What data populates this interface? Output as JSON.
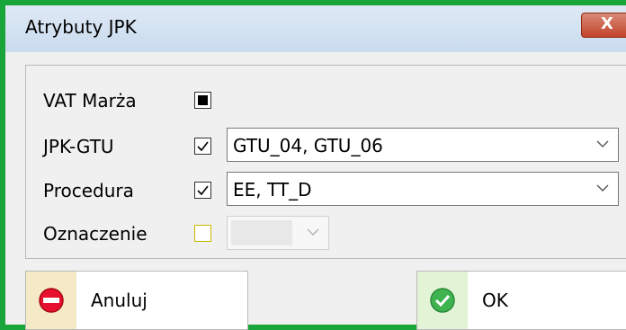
{
  "window": {
    "title": "Atrybuty JPK",
    "close_label": "X"
  },
  "form": {
    "vat_marza": {
      "label": "VAT Marża",
      "state": "indeterminate"
    },
    "jpk_gtu": {
      "label": "JPK-GTU",
      "checked": true,
      "value": "GTU_04, GTU_06"
    },
    "procedura": {
      "label": "Procedura",
      "checked": true,
      "value": "EE, TT_D"
    },
    "oznaczenie": {
      "label": "Oznaczenie",
      "checked": false,
      "value": ""
    }
  },
  "buttons": {
    "cancel_label": "Anuluj",
    "ok_label": "OK"
  },
  "colors": {
    "window_border": "#1aa53a",
    "close_button": "#c2432a",
    "cancel_icon": "#e8112d",
    "ok_icon": "#3fb34f"
  }
}
